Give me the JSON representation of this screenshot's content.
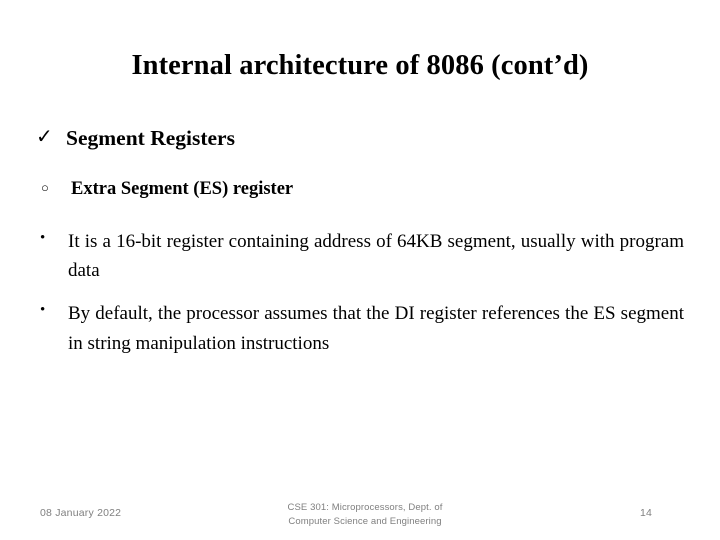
{
  "slide": {
    "title": "Internal architecture of 8086 (cont’d)",
    "background_color": "#ffffff",
    "text_color": "#000000",
    "footer_color": "#808080"
  },
  "bullets": [
    {
      "level": 1,
      "marker": "✓",
      "marker_name": "check-mark-bullet",
      "text": "Segment Registers"
    },
    {
      "level": 2,
      "marker": "○",
      "marker_name": "hollow-circle-bullet",
      "text": "Extra Segment (ES) register"
    },
    {
      "level": 3,
      "marker": "•",
      "marker_name": "solid-dot-bullet",
      "text": "It is a 16-bit register containing address of 64KB segment, usually with program data"
    },
    {
      "level": 3,
      "marker": "•",
      "marker_name": "solid-dot-bullet",
      "text": "By default, the processor assumes that the DI register references the ES segment in string manipulation instructions"
    }
  ],
  "footer": {
    "date": "08 January 2022",
    "center_line1": "CSE 301: Microprocessors, Dept. of",
    "center_line2": "Computer Science and Engineering",
    "page_number": "14"
  }
}
